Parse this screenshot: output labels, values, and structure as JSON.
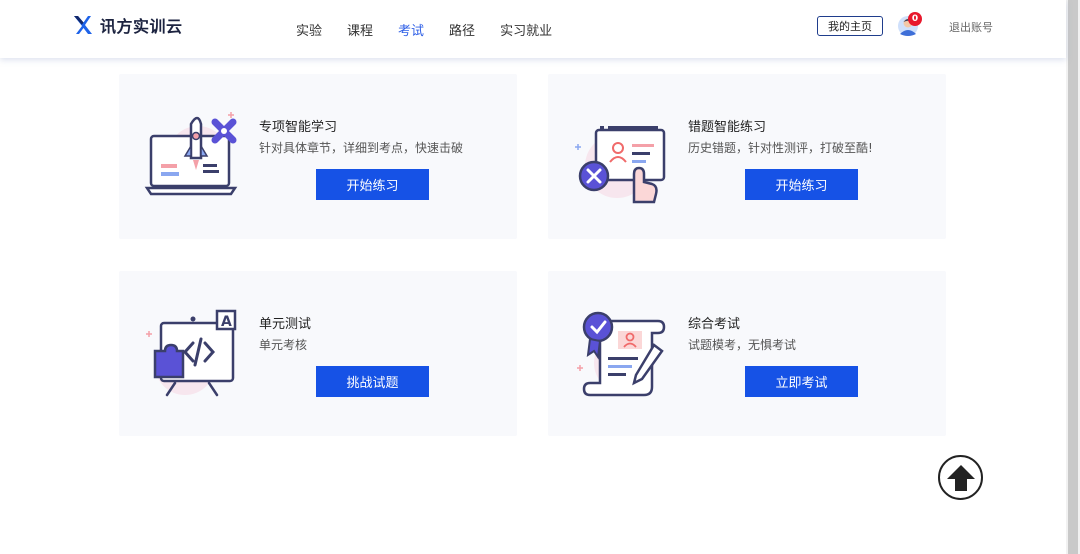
{
  "header": {
    "logo_text": "讯方实训云",
    "nav": [
      {
        "label": "实验",
        "active": false
      },
      {
        "label": "课程",
        "active": false
      },
      {
        "label": "考试",
        "active": true
      },
      {
        "label": "路径",
        "active": false
      },
      {
        "label": "实习就业",
        "active": false
      }
    ],
    "home_button": "我的主页",
    "notification_count": "0",
    "logout": "退出账号"
  },
  "cards": [
    {
      "title": "专项智能学习",
      "desc": "针对具体章节，详细到考点，快速击破",
      "button": "开始练习",
      "icon": "rocket-laptop-icon"
    },
    {
      "title": "错题智能练习",
      "desc": "历史错题，针对性测评，打破至酷!",
      "button": "开始练习",
      "icon": "mistake-card-icon"
    },
    {
      "title": "单元测试",
      "desc": "单元考核",
      "button": "挑战试题",
      "icon": "code-board-icon"
    },
    {
      "title": "综合考试",
      "desc": "试题模考，无惧考试",
      "button": "立即考试",
      "icon": "certificate-scroll-icon"
    }
  ],
  "colors": {
    "accent": "#1652e6",
    "nav_active": "#2e5fe6",
    "badge": "#e8182c",
    "card_bg": "#f8f9fc"
  }
}
